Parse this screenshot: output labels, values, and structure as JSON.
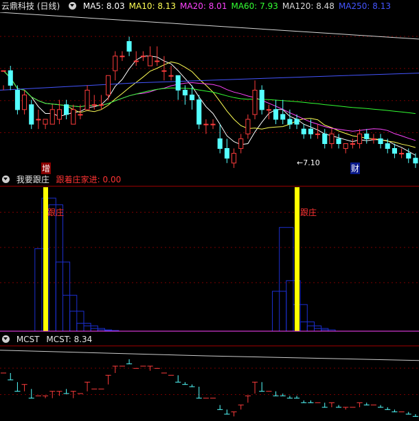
{
  "panel1": {
    "stock_title": "云鼎科技 (日线)",
    "ma": [
      {
        "label": "MA5: 8.03",
        "color": "#ffffff"
      },
      {
        "label": "MA10: 8.13",
        "color": "#ffff55"
      },
      {
        "label": "MA20: 8.01",
        "color": "#ff44ff"
      },
      {
        "label": "MA60: 7.93",
        "color": "#33ff33"
      },
      {
        "label": "MA120: 8.48",
        "color": "#d8d8d8"
      },
      {
        "label": "MA250: 8.13",
        "color": "#4455ff"
      }
    ],
    "low_annotation": "←7.10",
    "marker_left": "增",
    "marker_right": "财"
  },
  "panel2": {
    "title": "我要跟庄",
    "indicator_label": "跟着庄家进: 0.00",
    "bar_labels": [
      "跟庄",
      "跟庄"
    ]
  },
  "panel3": {
    "title": "MCST",
    "value_label": "MCST: 8.34"
  },
  "colors": {
    "up": "#ff3c3c",
    "down": "#54ffff",
    "grid": "#7a0000",
    "histogram": "#1c2fd0",
    "signal": "#ffff00"
  },
  "chart_data": [
    {
      "type": "candlestick",
      "title": "云鼎科技 (日线)",
      "x": [
        1,
        2,
        3,
        4,
        5,
        6,
        7,
        8,
        9,
        10,
        11,
        12,
        13,
        14,
        15,
        16,
        17,
        18,
        19,
        20,
        21,
        22,
        23,
        24,
        25,
        26,
        27,
        28,
        29,
        30,
        31,
        32,
        33,
        34,
        35,
        36,
        37,
        38,
        39,
        40,
        41,
        42,
        43,
        44,
        45,
        46,
        47,
        48,
        49,
        50,
        51,
        52,
        53,
        54,
        55,
        56,
        57,
        58,
        59,
        60
      ],
      "candles": [
        [
          8.6,
          8.6,
          8.3,
          8.2
        ],
        [
          8.6,
          8.3,
          8.7,
          8.2
        ],
        [
          8.2,
          7.8,
          8.3,
          7.7
        ],
        [
          7.8,
          8.1,
          8.2,
          7.7
        ],
        [
          7.9,
          7.5,
          8.0,
          7.4
        ],
        [
          7.6,
          7.6,
          7.8,
          7.4
        ],
        [
          7.5,
          7.6,
          7.6,
          7.4
        ],
        [
          7.5,
          7.8,
          7.9,
          7.5
        ],
        [
          7.6,
          7.8,
          8.0,
          7.5
        ],
        [
          7.9,
          7.7,
          8.0,
          7.6
        ],
        [
          7.5,
          7.8,
          7.9,
          7.5
        ],
        [
          7.7,
          7.7,
          7.9,
          7.6
        ],
        [
          7.8,
          8.2,
          8.3,
          7.8
        ],
        [
          7.9,
          7.9,
          8.1,
          7.8
        ],
        [
          7.9,
          7.9,
          8.1,
          7.8
        ],
        [
          8.1,
          8.5,
          8.5,
          8.0
        ],
        [
          8.6,
          8.9,
          9.0,
          8.4
        ],
        [
          8.9,
          8.9,
          9.0,
          8.8
        ],
        [
          9.2,
          9.0,
          9.3,
          8.9
        ],
        [
          8.8,
          8.8,
          9.0,
          8.7
        ],
        [
          8.9,
          8.9,
          9.0,
          8.8
        ],
        [
          8.7,
          8.9,
          9.1,
          8.7
        ],
        [
          8.8,
          8.8,
          9.1,
          8.7
        ],
        [
          8.6,
          8.6,
          8.9,
          8.4
        ],
        [
          8.5,
          8.5,
          8.7,
          8.4
        ],
        [
          8.5,
          8.2,
          8.5,
          8.0
        ],
        [
          8.2,
          8.1,
          8.3,
          7.9
        ],
        [
          8.1,
          8.0,
          8.3,
          7.8
        ],
        [
          8.0,
          7.5,
          8.1,
          7.4
        ],
        [
          7.5,
          7.5,
          7.6,
          7.3
        ],
        [
          7.5,
          7.5,
          7.6,
          7.4
        ],
        [
          7.2,
          7.0,
          7.5,
          6.9
        ],
        [
          7.0,
          6.8,
          7.2,
          6.7
        ],
        [
          6.7,
          6.9,
          7.0,
          6.6
        ],
        [
          7.0,
          7.2,
          7.3,
          6.9
        ],
        [
          7.3,
          7.6,
          7.7,
          7.2
        ],
        [
          7.7,
          8.2,
          8.4,
          7.6
        ],
        [
          8.2,
          7.8,
          8.3,
          7.7
        ],
        [
          7.8,
          7.8,
          7.9,
          7.6
        ],
        [
          7.8,
          7.6,
          8.0,
          7.5
        ],
        [
          7.7,
          7.6,
          8.0,
          7.5
        ],
        [
          7.6,
          7.5,
          7.8,
          7.4
        ],
        [
          7.6,
          7.5,
          7.7,
          7.4
        ],
        [
          7.4,
          7.3,
          7.5,
          7.2
        ],
        [
          7.4,
          7.3,
          7.6,
          7.2
        ],
        [
          7.3,
          7.3,
          7.5,
          7.2
        ],
        [
          7.3,
          7.1,
          7.4,
          7.0
        ],
        [
          7.1,
          7.3,
          7.4,
          7.0
        ],
        [
          7.2,
          7.1,
          7.3,
          7.0
        ],
        [
          7.0,
          7.1,
          7.1,
          6.9
        ],
        [
          7.1,
          7.1,
          7.2,
          7.0
        ],
        [
          7.1,
          7.3,
          7.4,
          7.0
        ],
        [
          7.3,
          7.2,
          7.4,
          7.1
        ],
        [
          7.2,
          7.2,
          7.3,
          7.1
        ],
        [
          7.2,
          7.1,
          7.3,
          7.0
        ],
        [
          7.1,
          7.0,
          7.2,
          6.9
        ],
        [
          7.0,
          6.9,
          7.1,
          6.8
        ],
        [
          6.9,
          6.9,
          7.0,
          6.8
        ],
        [
          6.9,
          6.8,
          7.0,
          6.7
        ],
        [
          6.8,
          6.7,
          6.9,
          6.6
        ]
      ]
    }
  ]
}
